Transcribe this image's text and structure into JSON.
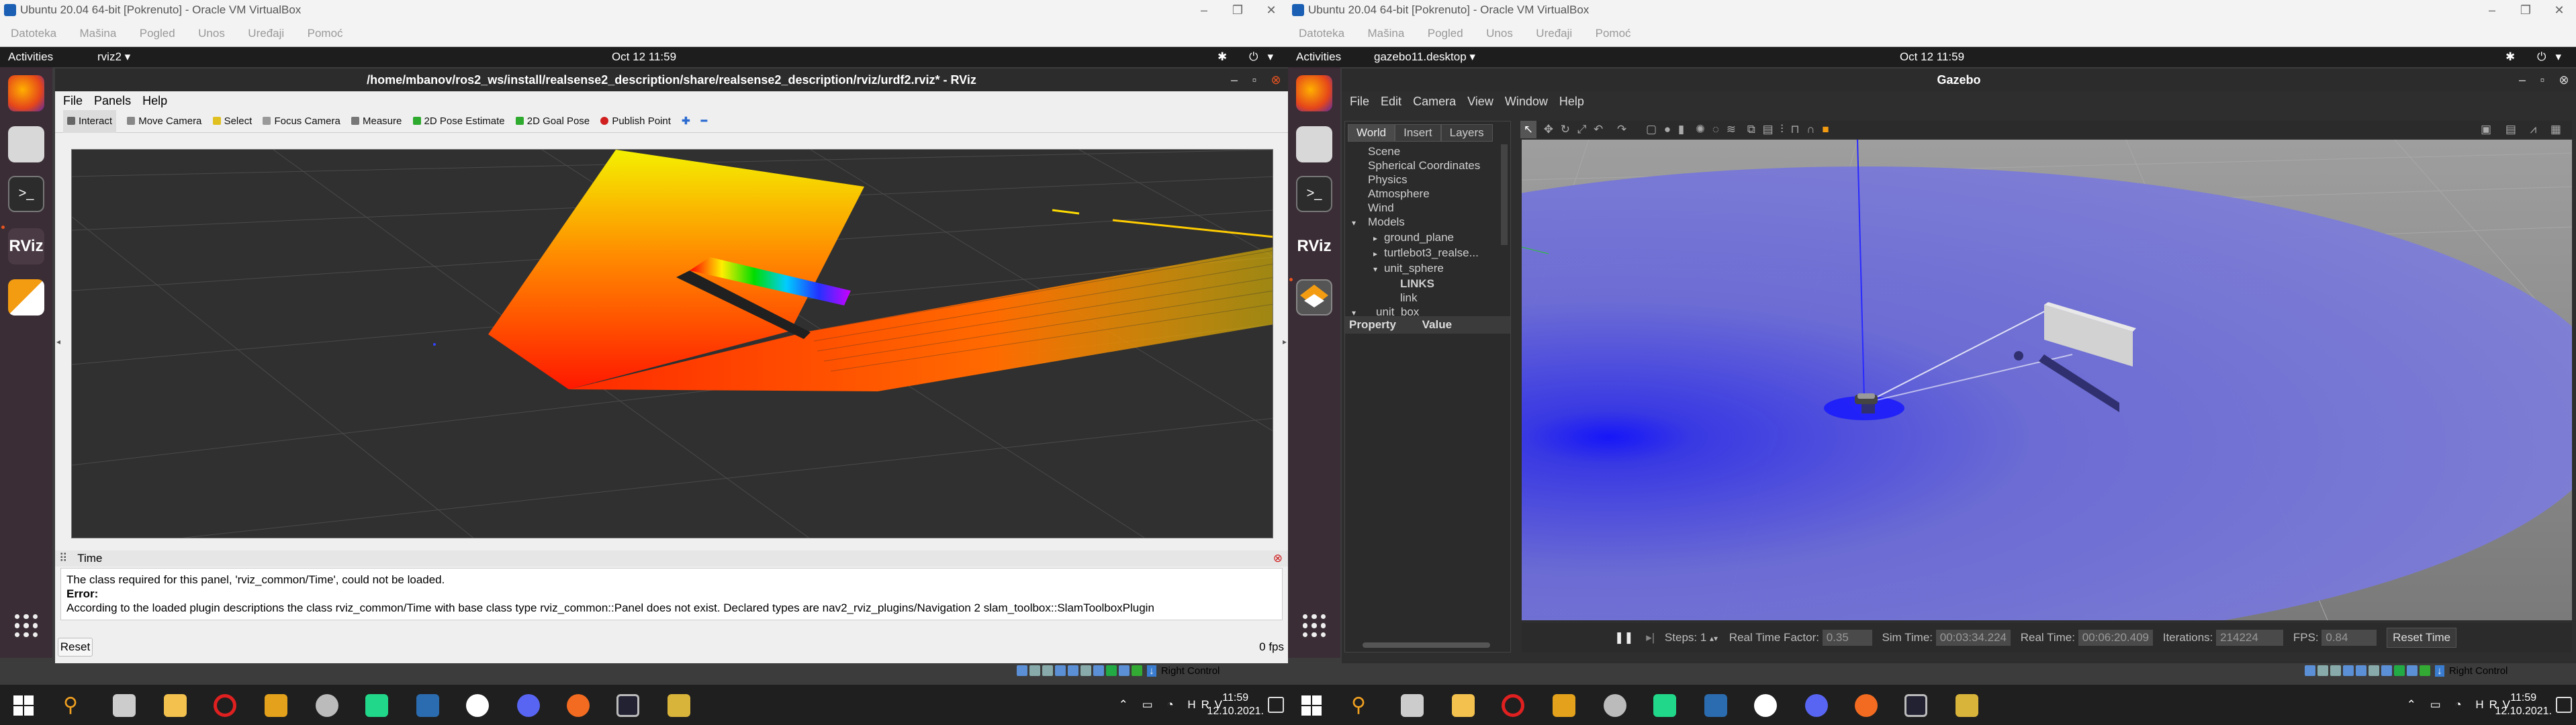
{
  "left": {
    "vbox": {
      "title": "Ubuntu 20.04 64-bit [Pokrenuto] - Oracle VM VirtualBox",
      "menu": [
        "Datoteka",
        "Mašina",
        "Pogled",
        "Unos",
        "Uređaji",
        "Pomoć"
      ]
    },
    "topbar": {
      "activities": "Activities",
      "app": "rviz2 ▾",
      "clock": "Oct 12  11:59"
    },
    "rviz": {
      "title": "/home/mbanov/ros2_ws/install/realsense2_description/share/realsense2_description/rviz/urdf2.rviz* - RViz",
      "menu": [
        "File",
        "Panels",
        "Help"
      ],
      "toolbar": [
        "Interact",
        "Move Camera",
        "Select",
        "Focus Camera",
        "Measure",
        "2D Pose Estimate",
        "2D Goal Pose",
        "Publish Point"
      ],
      "time_panel": "Time",
      "msg_line1": "The class required for this panel, 'rviz_common/Time', could not be loaded.",
      "msg_error": "Error:",
      "msg_line2": "According to the loaded plugin descriptions the class rviz_common/Time with base class type rviz_common::Panel does not exist. Declared types are nav2_rviz_plugins/Navigation 2 slam_toolbox::SlamToolboxPlugin",
      "reset": "Reset",
      "fps": "0 fps"
    },
    "status": {
      "right_control": "Right Control"
    },
    "taskbar": {
      "lang": "HRV",
      "time": "11:59",
      "date": "12.10.2021."
    }
  },
  "right": {
    "vbox": {
      "title": "Ubuntu 20.04 64-bit [Pokrenuto] - Oracle VM VirtualBox",
      "menu": [
        "Datoteka",
        "Mašina",
        "Pogled",
        "Unos",
        "Uređaji",
        "Pomoć"
      ]
    },
    "topbar": {
      "activities": "Activities",
      "app": "gazebo11.desktop ▾",
      "clock": "Oct 12  11:59"
    },
    "gazebo": {
      "title": "Gazebo",
      "menu": [
        "File",
        "Edit",
        "Camera",
        "View",
        "Window",
        "Help"
      ],
      "tabs": [
        "World",
        "Insert",
        "Layers"
      ],
      "tree": [
        "Scene",
        "Spherical Coordinates",
        "Physics",
        "Atmosphere",
        "Wind",
        "Models",
        "ground_plane",
        "turtlebot3_realse...",
        "unit_sphere",
        "LINKS",
        "link",
        "unit_box"
      ],
      "prop_headers": [
        "Property",
        "Value"
      ],
      "bottom": {
        "steps_label": "Steps: 1",
        "rtf_label": "Real Time Factor:",
        "rtf": "0.35",
        "sim_label": "Sim Time:",
        "sim": "00:03:34.224",
        "real_label": "Real Time:",
        "real": "00:06:20.409",
        "iter_label": "Iterations:",
        "iter": "214224",
        "fps_label": "FPS:",
        "fps": "0.84",
        "reset": "Reset Time"
      }
    },
    "status": {
      "right_control": "Right Control"
    },
    "taskbar": {
      "lang": "HRV",
      "time": "11:59",
      "date": "12.10.2021."
    }
  }
}
